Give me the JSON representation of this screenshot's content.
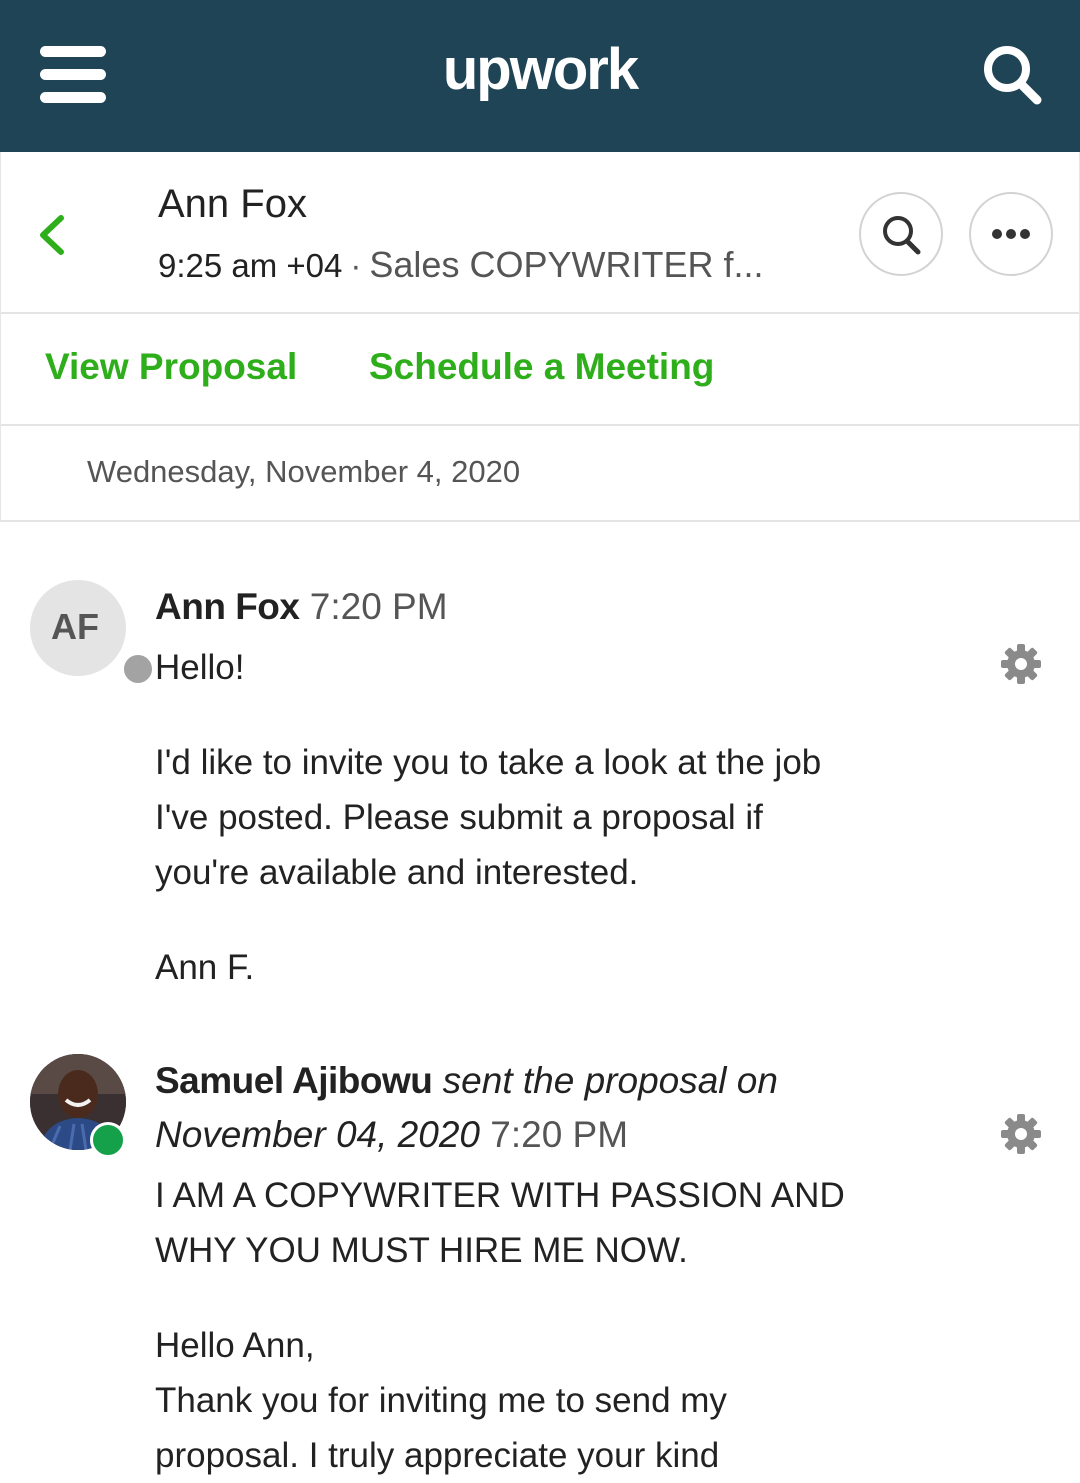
{
  "app": {
    "logo_text": "upwork"
  },
  "conversation": {
    "contact_name": "Ann Fox",
    "local_time": "9:25 am +04",
    "separator": "·",
    "job_title": "Sales COPYWRITER f..."
  },
  "actions": {
    "view_proposal": "View Proposal",
    "schedule_meeting": "Schedule a Meeting"
  },
  "date_divider": "Wednesday, November 4, 2020",
  "messages": [
    {
      "avatar_initials": "AF",
      "sender": "Ann Fox",
      "time": "7:20 PM",
      "status": "away",
      "lines": [
        "Hello!",
        "I'd like to invite you to take a look at the job",
        "I've posted. Please submit a proposal if",
        "you're available and interested.",
        "Ann F."
      ]
    },
    {
      "sender": "Samuel Ajibowu",
      "action_text": "sent the proposal on",
      "date_text": "November 04, 2020",
      "time": "7:20 PM",
      "status": "online",
      "lines": [
        "I AM A COPYWRITER WITH PASSION AND",
        "WHY YOU MUST HIRE ME NOW.",
        "Hello Ann,",
        "Thank you for inviting me to send my",
        "proposal. I truly appreciate your kind"
      ]
    }
  ],
  "colors": {
    "topbar": "#1f4455",
    "accent_green": "#2eae1a",
    "online": "#15a14a",
    "away": "#a3a3a3"
  },
  "icons": [
    "menu-icon",
    "search-icon",
    "back-arrow-icon",
    "more-icon",
    "gear-icon"
  ]
}
